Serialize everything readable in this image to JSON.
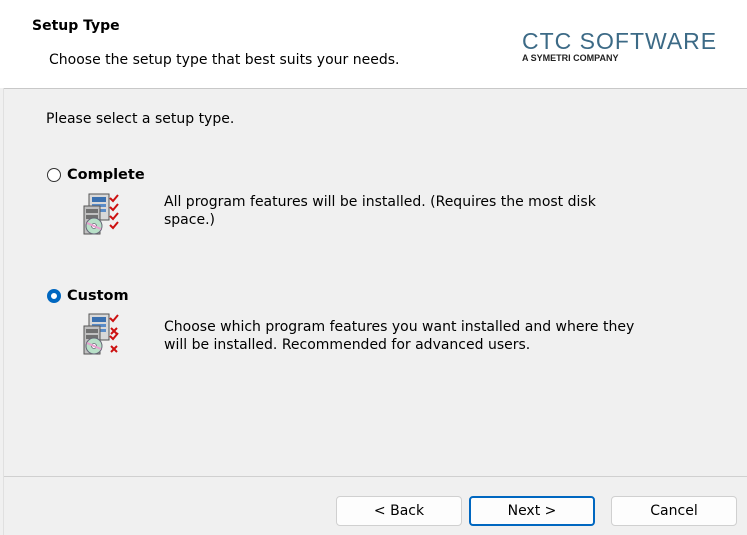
{
  "header": {
    "title": "Setup Type",
    "subtitle": "Choose the setup type that best suits your needs.",
    "logo_main": "CTC SOFTWARE",
    "logo_sub": "A SYMETRI COMPANY"
  },
  "body": {
    "prompt": "Please select a setup type.",
    "options": [
      {
        "label": "Complete",
        "selected": false,
        "description": "All program features will be installed. (Requires the most disk space.)",
        "icon": "complete-setup-icon"
      },
      {
        "label": "Custom",
        "selected": true,
        "description": "Choose which program features you want installed and where they will be installed. Recommended for advanced users.",
        "icon": "custom-setup-icon"
      }
    ]
  },
  "footer": {
    "back_label": "< Back",
    "next_label": "Next >",
    "cancel_label": "Cancel"
  },
  "colors": {
    "accent": "#0067c0",
    "logo": "#3c6a86"
  }
}
